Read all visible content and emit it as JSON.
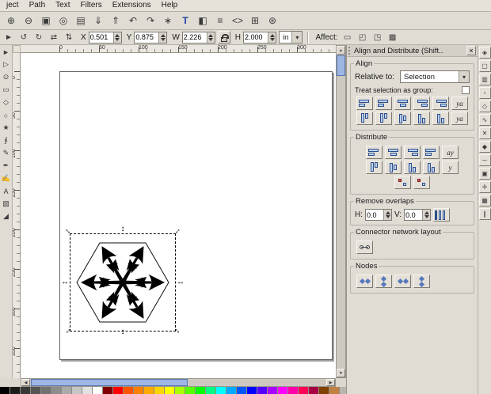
{
  "menubar": {
    "items": [
      "ject",
      "Path",
      "Text",
      "Filters",
      "Extensions",
      "Help"
    ]
  },
  "command_toolbar": {
    "buttons": [
      {
        "name": "zoom-in-icon",
        "glyph": "⊕"
      },
      {
        "name": "zoom-out-icon",
        "glyph": "⊖"
      },
      {
        "name": "zoom-page-icon",
        "glyph": "▣"
      },
      {
        "name": "zoom-drawing-icon",
        "glyph": "◎"
      },
      {
        "name": "print-icon",
        "glyph": "▤"
      },
      {
        "name": "import-icon",
        "glyph": "⇓"
      },
      {
        "name": "export-icon",
        "glyph": "⇑"
      },
      {
        "name": "undo-icon",
        "glyph": "↶"
      },
      {
        "name": "redo-icon",
        "glyph": "↷"
      },
      {
        "name": "duplicate-icon",
        "glyph": "∗"
      },
      {
        "name": "text-dialog-icon",
        "glyph": "T",
        "cls": "blue"
      },
      {
        "name": "fill-stroke-icon",
        "glyph": "◧"
      },
      {
        "name": "layers-icon",
        "glyph": "≡"
      },
      {
        "name": "xml-editor-icon",
        "glyph": "<>"
      },
      {
        "name": "align-dialog-icon",
        "glyph": "⊞"
      },
      {
        "name": "preferences-icon",
        "glyph": "⊛"
      }
    ]
  },
  "tool_options": {
    "buttons_left": [
      {
        "name": "selector-arrow-icon",
        "glyph": "►"
      },
      {
        "name": "rotate-ccw-icon",
        "glyph": "↺"
      },
      {
        "name": "rotate-cw-icon",
        "glyph": "↻"
      },
      {
        "name": "flip-horizontal-icon",
        "glyph": "⇄"
      },
      {
        "name": "flip-vertical-icon",
        "glyph": "⇅"
      }
    ],
    "x_label": "X",
    "x_value": "0.501",
    "y_label": "Y",
    "y_value": "0.875",
    "w_label": "W",
    "w_value": "2.226",
    "h_label": "H",
    "h_value": "2.000",
    "units_value": "in",
    "affect_label": "Affect:",
    "affect_buttons": [
      {
        "name": "scale-stroke-toggle-icon",
        "glyph": "▭"
      },
      {
        "name": "scale-corners-toggle-icon",
        "glyph": "◰"
      },
      {
        "name": "move-gradients-toggle-icon",
        "glyph": "◳"
      },
      {
        "name": "move-patterns-toggle-icon",
        "glyph": "▩"
      }
    ]
  },
  "toolbox": {
    "tools": [
      {
        "name": "tool-selector",
        "glyph": "►"
      },
      {
        "name": "tool-node-editor",
        "glyph": "▷"
      },
      {
        "name": "tool-zoom",
        "glyph": "⊙"
      },
      {
        "name": "tool-rectangle",
        "glyph": "▭"
      },
      {
        "name": "tool-3dbox",
        "glyph": "◇"
      },
      {
        "name": "tool-ellipse",
        "glyph": "○"
      },
      {
        "name": "tool-star",
        "glyph": "★"
      },
      {
        "name": "tool-spiral",
        "glyph": "∮"
      },
      {
        "name": "tool-pencil",
        "glyph": "✎"
      },
      {
        "name": "tool-pen",
        "glyph": "✒"
      },
      {
        "name": "tool-calligraphy",
        "glyph": "✍"
      },
      {
        "name": "tool-text",
        "glyph": "A"
      },
      {
        "name": "tool-gradient",
        "glyph": "▧"
      },
      {
        "name": "tool-dropper",
        "glyph": "◢"
      }
    ]
  },
  "rulers": {
    "horizontal": [
      "0",
      "50",
      "100",
      "150",
      "200",
      "250",
      "300"
    ],
    "vertical": [
      "0",
      "50",
      "100",
      "150",
      "200",
      "250",
      "300",
      "350"
    ]
  },
  "dock": {
    "title": "Align and Distribute (Shift..",
    "align": {
      "label": "Align",
      "relative_label": "Relative to:",
      "relative_value": "Selection",
      "group_label": "Treat selection as group:",
      "row1": [
        {
          "name": "align-right-edges-to-anchor-left-button",
          "cls": ""
        },
        {
          "name": "align-left-edges-button",
          "cls": ""
        },
        {
          "name": "center-on-vertical-axis-button",
          "cls": "c"
        },
        {
          "name": "align-right-edges-button",
          "cls": "r"
        },
        {
          "name": "align-left-edges-to-anchor-right-button",
          "cls": "r"
        },
        {
          "name": "align-text-anchors-horizontal-button",
          "cls": "txt",
          "text": "ya"
        }
      ],
      "row2": [
        {
          "name": "align-bottom-edges-to-anchor-top-button",
          "cls": "v t"
        },
        {
          "name": "align-top-edges-button",
          "cls": "v t"
        },
        {
          "name": "center-on-horizontal-axis-button",
          "cls": "v c"
        },
        {
          "name": "align-bottom-edges-button",
          "cls": "v"
        },
        {
          "name": "align-top-edges-to-anchor-bottom-button",
          "cls": "v"
        },
        {
          "name": "align-text-anchors-vertical-button",
          "cls": "txt",
          "text": "ya"
        }
      ]
    },
    "distribute": {
      "label": "Distribute",
      "row1": [
        {
          "name": "distribute-left-edges-button",
          "cls": ""
        },
        {
          "name": "distribute-centers-horizontally-button",
          "cls": "c"
        },
        {
          "name": "distribute-right-edges-button",
          "cls": "r"
        },
        {
          "name": "make-horizontal-gaps-equal-button",
          "cls": ""
        },
        {
          "name": "distribute-text-anchors-horizontal-button",
          "cls": "txt",
          "text": "ay"
        }
      ],
      "row2": [
        {
          "name": "distribute-top-edges-button",
          "cls": "v t"
        },
        {
          "name": "distribute-centers-vertically-button",
          "cls": "v c"
        },
        {
          "name": "distribute-bottom-edges-button",
          "cls": "v"
        },
        {
          "name": "make-vertical-gaps-equal-button",
          "cls": "v"
        },
        {
          "name": "distribute-text-anchors-vertical-button",
          "cls": "txt",
          "text": "y"
        }
      ],
      "row3": [
        {
          "name": "randomize-centers-button",
          "cls": "dots"
        },
        {
          "name": "unclump-objects-button",
          "cls": "dots"
        }
      ]
    },
    "remove_overlaps": {
      "label": "Remove overlaps",
      "h_label": "H:",
      "h_value": "0.0",
      "v_label": "V:",
      "v_value": "0.0",
      "buttons": [
        {
          "name": "remove-overlaps-button",
          "cls": "bars"
        }
      ]
    },
    "connector": {
      "label": "Connector network layout",
      "buttons": [
        {
          "name": "arrange-connector-network-button",
          "cls": "net"
        }
      ]
    },
    "nodes": {
      "label": "Nodes",
      "buttons": [
        {
          "name": "align-nodes-horizontally-button",
          "cls": "nd"
        },
        {
          "name": "align-nodes-vertically-button",
          "cls": "nd v"
        },
        {
          "name": "distribute-nodes-horizontally-button",
          "cls": "nd"
        },
        {
          "name": "distribute-nodes-vertically-button",
          "cls": "nd v"
        }
      ]
    }
  },
  "snapbar": {
    "buttons": [
      {
        "name": "snap-enable-icon",
        "glyph": "◈"
      },
      {
        "name": "snap-bbox-icon",
        "glyph": "▢"
      },
      {
        "name": "snap-bbox-edges-icon",
        "glyph": "▥"
      },
      {
        "name": "snap-bbox-corners-icon",
        "glyph": "▫"
      },
      {
        "name": "snap-nodes-icon",
        "glyph": "◇"
      },
      {
        "name": "snap-paths-icon",
        "glyph": "∿"
      },
      {
        "name": "snap-path-intersections-icon",
        "glyph": "✕"
      },
      {
        "name": "snap-cusp-nodes-icon",
        "glyph": "◆"
      },
      {
        "name": "snap-midpoints-icon",
        "glyph": "─"
      },
      {
        "name": "snap-object-centers-icon",
        "glyph": "▣"
      },
      {
        "name": "snap-rotation-centers-icon",
        "glyph": "✛"
      },
      {
        "name": "snap-grid-icon",
        "glyph": "▦"
      },
      {
        "name": "snap-guides-icon",
        "glyph": "∥"
      }
    ]
  },
  "palette": {
    "colors": [
      "#000000",
      "#1c1c1c",
      "#383838",
      "#555555",
      "#717171",
      "#8d8d8d",
      "#aaaaaa",
      "#c6c6c6",
      "#e2e2e2",
      "#ffffff",
      "#800000",
      "#ff0000",
      "#ff5500",
      "#ff8000",
      "#ffaa00",
      "#ffd500",
      "#ffff00",
      "#aaff00",
      "#55ff00",
      "#00ff00",
      "#00ff80",
      "#00ffff",
      "#00aaff",
      "#0055ff",
      "#0000ff",
      "#5500ff",
      "#aa00ff",
      "#ff00ff",
      "#ff00aa",
      "#ff0055",
      "#aa0044",
      "#804000",
      "#c08040"
    ]
  }
}
